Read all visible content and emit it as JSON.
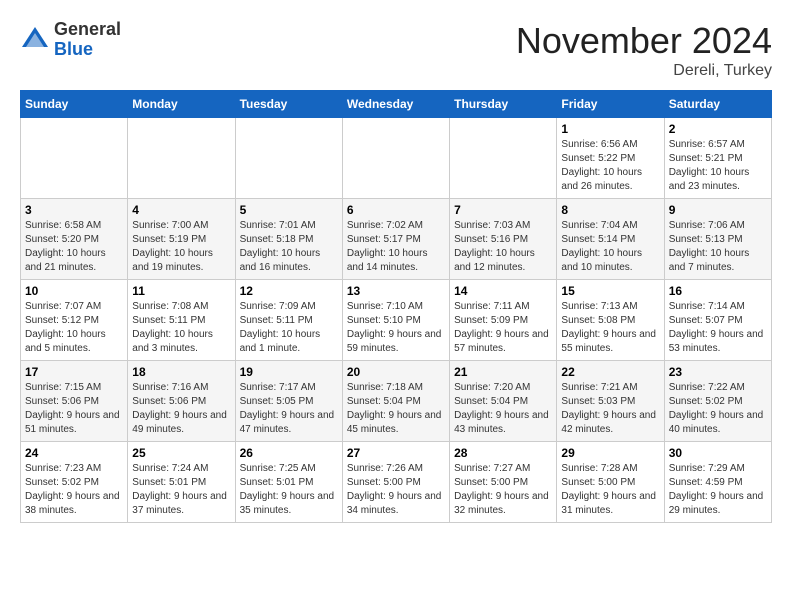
{
  "header": {
    "logo_general": "General",
    "logo_blue": "Blue",
    "month_title": "November 2024",
    "location": "Dereli, Turkey"
  },
  "weekdays": [
    "Sunday",
    "Monday",
    "Tuesday",
    "Wednesday",
    "Thursday",
    "Friday",
    "Saturday"
  ],
  "weeks": [
    [
      {
        "day": "",
        "info": ""
      },
      {
        "day": "",
        "info": ""
      },
      {
        "day": "",
        "info": ""
      },
      {
        "day": "",
        "info": ""
      },
      {
        "day": "",
        "info": ""
      },
      {
        "day": "1",
        "info": "Sunrise: 6:56 AM\nSunset: 5:22 PM\nDaylight: 10 hours and 26 minutes."
      },
      {
        "day": "2",
        "info": "Sunrise: 6:57 AM\nSunset: 5:21 PM\nDaylight: 10 hours and 23 minutes."
      }
    ],
    [
      {
        "day": "3",
        "info": "Sunrise: 6:58 AM\nSunset: 5:20 PM\nDaylight: 10 hours and 21 minutes."
      },
      {
        "day": "4",
        "info": "Sunrise: 7:00 AM\nSunset: 5:19 PM\nDaylight: 10 hours and 19 minutes."
      },
      {
        "day": "5",
        "info": "Sunrise: 7:01 AM\nSunset: 5:18 PM\nDaylight: 10 hours and 16 minutes."
      },
      {
        "day": "6",
        "info": "Sunrise: 7:02 AM\nSunset: 5:17 PM\nDaylight: 10 hours and 14 minutes."
      },
      {
        "day": "7",
        "info": "Sunrise: 7:03 AM\nSunset: 5:16 PM\nDaylight: 10 hours and 12 minutes."
      },
      {
        "day": "8",
        "info": "Sunrise: 7:04 AM\nSunset: 5:14 PM\nDaylight: 10 hours and 10 minutes."
      },
      {
        "day": "9",
        "info": "Sunrise: 7:06 AM\nSunset: 5:13 PM\nDaylight: 10 hours and 7 minutes."
      }
    ],
    [
      {
        "day": "10",
        "info": "Sunrise: 7:07 AM\nSunset: 5:12 PM\nDaylight: 10 hours and 5 minutes."
      },
      {
        "day": "11",
        "info": "Sunrise: 7:08 AM\nSunset: 5:11 PM\nDaylight: 10 hours and 3 minutes."
      },
      {
        "day": "12",
        "info": "Sunrise: 7:09 AM\nSunset: 5:11 PM\nDaylight: 10 hours and 1 minute."
      },
      {
        "day": "13",
        "info": "Sunrise: 7:10 AM\nSunset: 5:10 PM\nDaylight: 9 hours and 59 minutes."
      },
      {
        "day": "14",
        "info": "Sunrise: 7:11 AM\nSunset: 5:09 PM\nDaylight: 9 hours and 57 minutes."
      },
      {
        "day": "15",
        "info": "Sunrise: 7:13 AM\nSunset: 5:08 PM\nDaylight: 9 hours and 55 minutes."
      },
      {
        "day": "16",
        "info": "Sunrise: 7:14 AM\nSunset: 5:07 PM\nDaylight: 9 hours and 53 minutes."
      }
    ],
    [
      {
        "day": "17",
        "info": "Sunrise: 7:15 AM\nSunset: 5:06 PM\nDaylight: 9 hours and 51 minutes."
      },
      {
        "day": "18",
        "info": "Sunrise: 7:16 AM\nSunset: 5:06 PM\nDaylight: 9 hours and 49 minutes."
      },
      {
        "day": "19",
        "info": "Sunrise: 7:17 AM\nSunset: 5:05 PM\nDaylight: 9 hours and 47 minutes."
      },
      {
        "day": "20",
        "info": "Sunrise: 7:18 AM\nSunset: 5:04 PM\nDaylight: 9 hours and 45 minutes."
      },
      {
        "day": "21",
        "info": "Sunrise: 7:20 AM\nSunset: 5:04 PM\nDaylight: 9 hours and 43 minutes."
      },
      {
        "day": "22",
        "info": "Sunrise: 7:21 AM\nSunset: 5:03 PM\nDaylight: 9 hours and 42 minutes."
      },
      {
        "day": "23",
        "info": "Sunrise: 7:22 AM\nSunset: 5:02 PM\nDaylight: 9 hours and 40 minutes."
      }
    ],
    [
      {
        "day": "24",
        "info": "Sunrise: 7:23 AM\nSunset: 5:02 PM\nDaylight: 9 hours and 38 minutes."
      },
      {
        "day": "25",
        "info": "Sunrise: 7:24 AM\nSunset: 5:01 PM\nDaylight: 9 hours and 37 minutes."
      },
      {
        "day": "26",
        "info": "Sunrise: 7:25 AM\nSunset: 5:01 PM\nDaylight: 9 hours and 35 minutes."
      },
      {
        "day": "27",
        "info": "Sunrise: 7:26 AM\nSunset: 5:00 PM\nDaylight: 9 hours and 34 minutes."
      },
      {
        "day": "28",
        "info": "Sunrise: 7:27 AM\nSunset: 5:00 PM\nDaylight: 9 hours and 32 minutes."
      },
      {
        "day": "29",
        "info": "Sunrise: 7:28 AM\nSunset: 5:00 PM\nDaylight: 9 hours and 31 minutes."
      },
      {
        "day": "30",
        "info": "Sunrise: 7:29 AM\nSunset: 4:59 PM\nDaylight: 9 hours and 29 minutes."
      }
    ]
  ]
}
